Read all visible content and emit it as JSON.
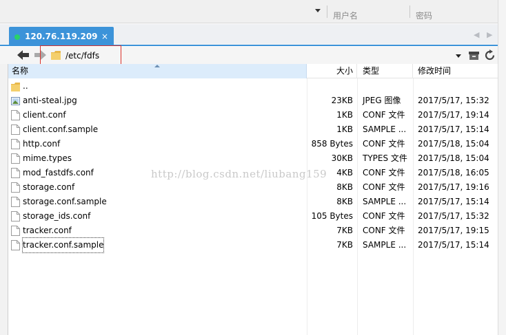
{
  "connect": {
    "username_placeholder": "用户名",
    "password_placeholder": "密码"
  },
  "session": {
    "tab_host": "120.76.119.209",
    "tab_close": "×",
    "status_color": "#29d16b"
  },
  "address": {
    "path": "/etc/fdfs"
  },
  "columns": {
    "name": "名称",
    "size": "大小",
    "type": "类型",
    "modified": "修改时间"
  },
  "files": [
    {
      "name": "..",
      "size": "",
      "type": "",
      "modified": "",
      "icon": "folder-icon"
    },
    {
      "name": "anti-steal.jpg",
      "size": "23KB",
      "type": "JPEG 图像",
      "modified": "2017/5/17, 15:32",
      "icon": "image-file-icon"
    },
    {
      "name": "client.conf",
      "size": "1KB",
      "type": "CONF 文件",
      "modified": "2017/5/17, 19:14",
      "icon": "file-icon"
    },
    {
      "name": "client.conf.sample",
      "size": "1KB",
      "type": "SAMPLE ...",
      "modified": "2017/5/17, 15:14",
      "icon": "file-icon"
    },
    {
      "name": "http.conf",
      "size": "858 Bytes",
      "type": "CONF 文件",
      "modified": "2017/5/18, 15:04",
      "icon": "file-icon"
    },
    {
      "name": "mime.types",
      "size": "30KB",
      "type": "TYPES 文件",
      "modified": "2017/5/18, 15:04",
      "icon": "file-icon"
    },
    {
      "name": "mod_fastdfs.conf",
      "size": "4KB",
      "type": "CONF 文件",
      "modified": "2017/5/18, 16:05",
      "icon": "file-icon"
    },
    {
      "name": "storage.conf",
      "size": "8KB",
      "type": "CONF 文件",
      "modified": "2017/5/17, 19:16",
      "icon": "file-icon"
    },
    {
      "name": "storage.conf.sample",
      "size": "8KB",
      "type": "SAMPLE ...",
      "modified": "2017/5/17, 15:14",
      "icon": "file-icon"
    },
    {
      "name": "storage_ids.conf",
      "size": "105 Bytes",
      "type": "CONF 文件",
      "modified": "2017/5/17, 15:32",
      "icon": "file-icon"
    },
    {
      "name": "tracker.conf",
      "size": "7KB",
      "type": "CONF 文件",
      "modified": "2017/5/17, 19:15",
      "icon": "file-icon"
    },
    {
      "name": "tracker.conf.sample",
      "size": "7KB",
      "type": "SAMPLE ...",
      "modified": "2017/5/17, 15:14",
      "icon": "file-icon"
    }
  ],
  "watermark": "http://blog.csdn.net/liubang159",
  "colors": {
    "tab_active": "#3c93d9",
    "path_highlight": "#d9302a",
    "header_selected": "#dcecfb"
  }
}
